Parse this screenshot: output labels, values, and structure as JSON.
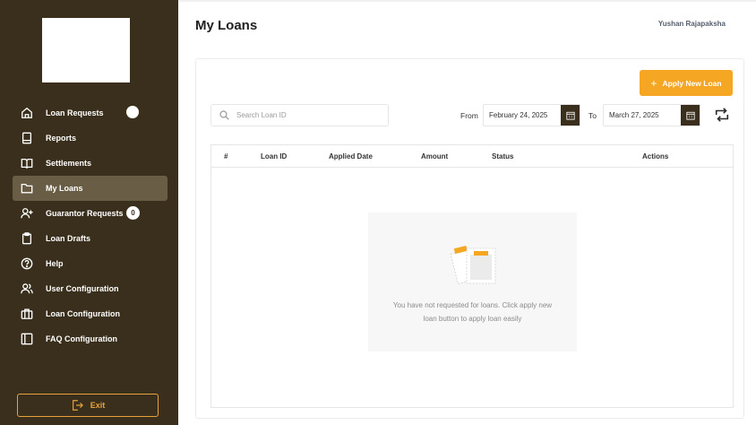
{
  "sidebar": {
    "items": [
      {
        "label": "Loan Requests",
        "icon": "home-icon",
        "badge": ""
      },
      {
        "label": "Reports",
        "icon": "report-icon",
        "badge": null
      },
      {
        "label": "Settlements",
        "icon": "book-icon",
        "badge": null
      },
      {
        "label": "My Loans",
        "icon": "folder-icon",
        "badge": null,
        "active": true
      },
      {
        "label": "Guarantor Requests",
        "icon": "user-plus-icon",
        "badge": "0"
      },
      {
        "label": "Loan Drafts",
        "icon": "clipboard-icon",
        "badge": null
      },
      {
        "label": "Help",
        "icon": "help-icon",
        "badge": null
      },
      {
        "label": "User Configuration",
        "icon": "users-icon",
        "badge": null
      },
      {
        "label": "Loan Configuration",
        "icon": "briefcase-icon",
        "badge": null
      },
      {
        "label": "FAQ Configuration",
        "icon": "layout-icon",
        "badge": null
      }
    ],
    "exit_label": "Exit"
  },
  "header": {
    "title": "My Loans",
    "user_name": "Yushan Rajapaksha"
  },
  "toolbar": {
    "apply_label": "Apply New Loan",
    "search_placeholder": "Search Loan ID",
    "from_label": "From",
    "from_date": "February 24, 2025",
    "to_label": "To",
    "to_date": "March 27, 2025"
  },
  "table": {
    "columns": [
      "#",
      "Loan ID",
      "Applied Date",
      "Amount",
      "Status",
      "Actions"
    ],
    "rows": []
  },
  "empty_state": {
    "message": "You have not requested for loans. Click apply new loan button to apply loan easily"
  },
  "colors": {
    "sidebar_bg": "#3a2f1c",
    "sidebar_active": "#6a5d45",
    "accent": "#f5a623"
  }
}
